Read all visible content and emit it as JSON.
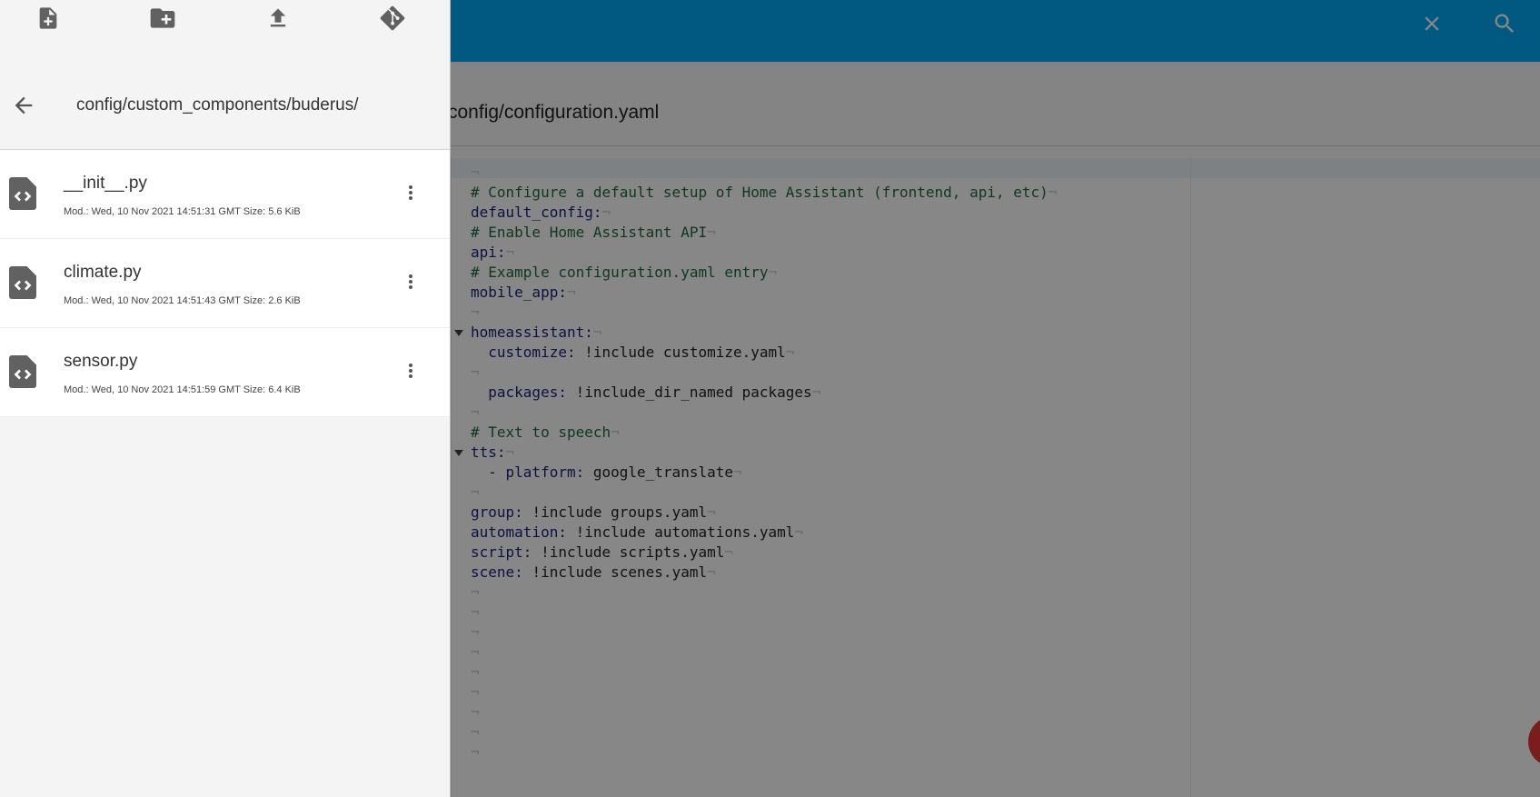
{
  "colors": {
    "topbar": "#03a9f4",
    "fab": "#e53935",
    "comment": "#1b6d3e",
    "key": "#1a237e"
  },
  "header": {
    "close_icon": "close-icon",
    "search_icon": "search-icon"
  },
  "editor": {
    "file_path": "config/configuration.yaml",
    "lines": [
      {
        "segments": [
          {
            "t": "",
            "cls": "v"
          }
        ]
      },
      {
        "segments": [
          {
            "t": "# Configure a default setup of Home Assistant (frontend, api, etc)",
            "cls": "c"
          }
        ]
      },
      {
        "segments": [
          {
            "t": "default_config:",
            "cls": "k"
          }
        ]
      },
      {
        "segments": [
          {
            "t": "# Enable Home Assistant API",
            "cls": "c"
          }
        ]
      },
      {
        "segments": [
          {
            "t": "api:",
            "cls": "k"
          }
        ]
      },
      {
        "segments": [
          {
            "t": "# Example configuration.yaml entry",
            "cls": "c"
          }
        ]
      },
      {
        "segments": [
          {
            "t": "mobile_app:",
            "cls": "k"
          }
        ]
      },
      {
        "segments": [
          {
            "t": "",
            "cls": "v"
          }
        ]
      },
      {
        "fold": true,
        "segments": [
          {
            "t": "homeassistant:",
            "cls": "k"
          }
        ]
      },
      {
        "segments": [
          {
            "t": "  customize: ",
            "cls": "k"
          },
          {
            "t": "!include customize.yaml",
            "cls": "v"
          }
        ]
      },
      {
        "segments": [
          {
            "t": "",
            "cls": "v"
          }
        ]
      },
      {
        "segments": [
          {
            "t": "  packages: ",
            "cls": "k"
          },
          {
            "t": "!include_dir_named packages",
            "cls": "v"
          }
        ]
      },
      {
        "segments": [
          {
            "t": "",
            "cls": "v"
          }
        ]
      },
      {
        "segments": [
          {
            "t": "# Text to speech",
            "cls": "c"
          }
        ]
      },
      {
        "fold": true,
        "segments": [
          {
            "t": "tts:",
            "cls": "k"
          }
        ]
      },
      {
        "segments": [
          {
            "t": "  - ",
            "cls": "v"
          },
          {
            "t": "platform: ",
            "cls": "k"
          },
          {
            "t": "google_translate",
            "cls": "v"
          }
        ]
      },
      {
        "segments": [
          {
            "t": "",
            "cls": "v"
          }
        ]
      },
      {
        "segments": [
          {
            "t": "group: ",
            "cls": "k"
          },
          {
            "t": "!include groups.yaml",
            "cls": "v"
          }
        ]
      },
      {
        "segments": [
          {
            "t": "automation: ",
            "cls": "k"
          },
          {
            "t": "!include automations.yaml",
            "cls": "v"
          }
        ]
      },
      {
        "segments": [
          {
            "t": "script: ",
            "cls": "k"
          },
          {
            "t": "!include scripts.yaml",
            "cls": "v"
          }
        ]
      },
      {
        "segments": [
          {
            "t": "scene: ",
            "cls": "k"
          },
          {
            "t": "!include scenes.yaml",
            "cls": "v"
          }
        ]
      },
      {
        "segments": [
          {
            "t": "",
            "cls": "v"
          }
        ]
      },
      {
        "segments": [
          {
            "t": "",
            "cls": "v"
          }
        ]
      },
      {
        "segments": [
          {
            "t": "",
            "cls": "v"
          }
        ]
      },
      {
        "segments": [
          {
            "t": "",
            "cls": "v"
          }
        ]
      },
      {
        "segments": [
          {
            "t": "",
            "cls": "v"
          }
        ]
      },
      {
        "segments": [
          {
            "t": "",
            "cls": "v"
          }
        ]
      },
      {
        "segments": [
          {
            "t": "",
            "cls": "v"
          }
        ]
      },
      {
        "segments": [
          {
            "t": "",
            "cls": "v"
          }
        ]
      },
      {
        "segments": [
          {
            "t": "",
            "cls": "v"
          }
        ]
      }
    ]
  },
  "drawer": {
    "toolbar": {
      "new_file_icon": "new-file-icon",
      "new_folder_icon": "new-folder-icon",
      "upload_icon": "upload-icon",
      "git_icon": "git-icon"
    },
    "back_icon": "arrow-back-icon",
    "path": "config/custom_components/buderus/",
    "files": [
      {
        "name": "__init__.py",
        "meta": "Mod.: Wed, 10 Nov 2021 14:51:31 GMT  Size: 5.6 KiB"
      },
      {
        "name": "climate.py",
        "meta": "Mod.: Wed, 10 Nov 2021 14:51:43 GMT  Size: 2.6 KiB"
      },
      {
        "name": "sensor.py",
        "meta": "Mod.: Wed, 10 Nov 2021 14:51:59 GMT  Size: 6.4 KiB"
      }
    ]
  }
}
